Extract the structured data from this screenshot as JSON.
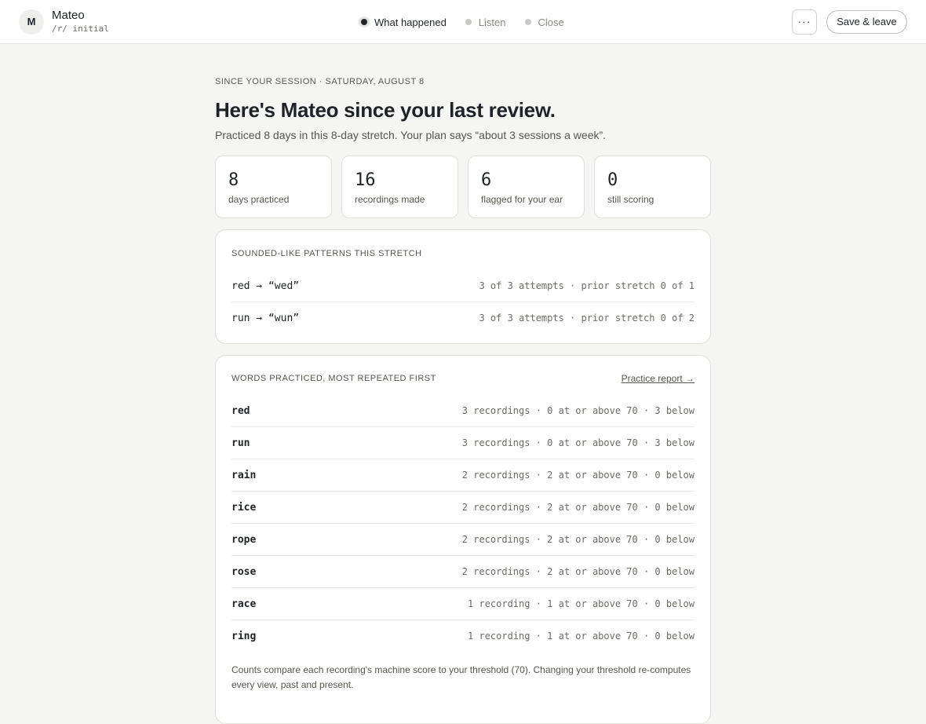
{
  "header": {
    "avatar_initial": "M",
    "student_name": "Mateo",
    "student_sub": "/r/ initial",
    "steps": [
      {
        "label": "What happened",
        "active": true
      },
      {
        "label": "Listen",
        "active": false
      },
      {
        "label": "Close",
        "active": false
      }
    ],
    "more_label": "···",
    "save_label": "Save & leave"
  },
  "summary": {
    "eyebrow": "SINCE YOUR SESSION · SATURDAY, AUGUST 8",
    "headline": "Here's Mateo since your last review.",
    "text": "Practiced 8 days in this 8-day stretch. Your plan says “about 3 sessions a week”."
  },
  "stats": [
    {
      "value": "8",
      "label": "days practiced"
    },
    {
      "value": "16",
      "label": "recordings made"
    },
    {
      "value": "6",
      "label": "flagged for your ear"
    },
    {
      "value": "0",
      "label": "still scoring"
    }
  ],
  "patterns": {
    "title": "SOUNDED-LIKE PATTERNS THIS STRETCH",
    "rows": [
      {
        "word": "red → “wed”",
        "detail": "3 of 3 attempts · prior stretch 0 of 1"
      },
      {
        "word": "run → “wun”",
        "detail": "3 of 3 attempts · prior stretch 0 of 2"
      }
    ]
  },
  "words": {
    "title": "WORDS PRACTICED, MOST REPEATED FIRST",
    "link_label": "Practice report →",
    "rows": [
      {
        "word": "red",
        "detail": "3 recordings · 0 at or above 70 · 3 below"
      },
      {
        "word": "run",
        "detail": "3 recordings · 0 at or above 70 · 3 below"
      },
      {
        "word": "rain",
        "detail": "2 recordings · 2 at or above 70 · 0 below"
      },
      {
        "word": "rice",
        "detail": "2 recordings · 2 at or above 70 · 0 below"
      },
      {
        "word": "rope",
        "detail": "2 recordings · 2 at or above 70 · 0 below"
      },
      {
        "word": "rose",
        "detail": "2 recordings · 2 at or above 70 · 0 below"
      },
      {
        "word": "race",
        "detail": "1 recording · 1 at or above 70 · 0 below"
      },
      {
        "word": "ring",
        "detail": "1 recording · 1 at or above 70 · 0 below"
      }
    ],
    "footnote": "Counts compare each recording's machine score to your threshold (70). Changing your threshold re-computes every view, past and present."
  }
}
